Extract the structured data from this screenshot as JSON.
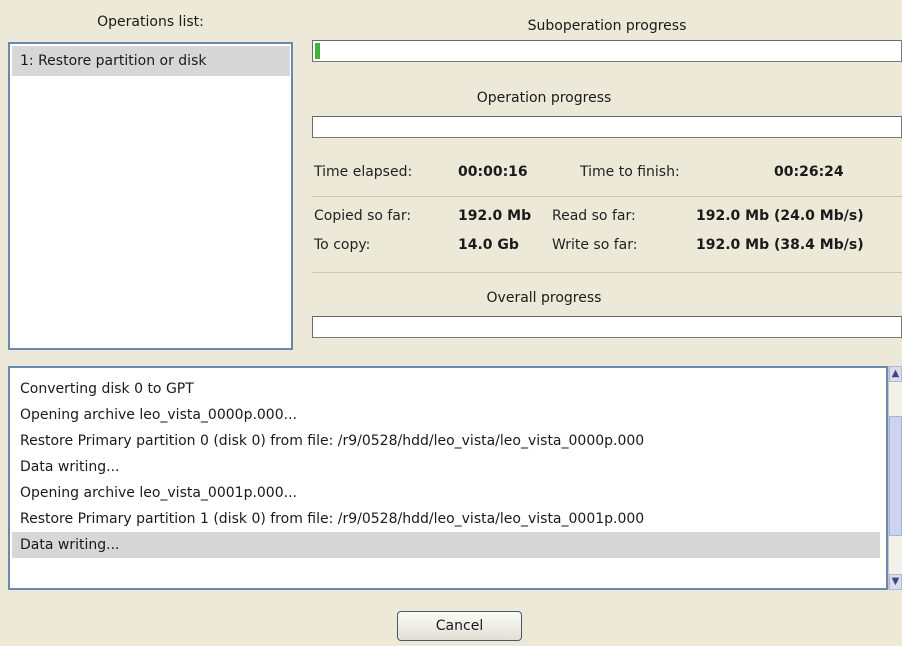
{
  "operations": {
    "header": "Operations list:",
    "items": [
      "1: Restore partition or disk"
    ]
  },
  "progress": {
    "sub_header": "Suboperation progress",
    "sub_fraction": 0.004,
    "op_header": "Operation progress",
    "op_fraction": 0.0,
    "overall_header": "Overall progress",
    "overall_fraction": 0.0
  },
  "stats": {
    "time_elapsed_label": "Time elapsed:",
    "time_elapsed_value": "00:00:16",
    "time_to_finish_label": "Time to finish:",
    "time_to_finish_value": "00:26:24",
    "copied_label": "Copied so far:",
    "copied_value": "192.0 Mb",
    "to_copy_label": "To copy:",
    "to_copy_value": "14.0 Gb",
    "read_label": "Read so far:",
    "read_value": "192.0 Mb (24.0 Mb/s)",
    "write_label": "Write so far:",
    "write_value": "192.0 Mb (38.4 Mb/s)"
  },
  "log": {
    "lines": [
      "Converting disk 0 to GPT",
      "Opening archive leo_vista_0000p.000...",
      "Restore Primary partition 0 (disk 0) from file: /r9/0528/hdd/leo_vista/leo_vista_0000p.000",
      "Data writing...",
      "Opening archive leo_vista_0001p.000...",
      "Restore Primary partition 1 (disk 0) from file: /r9/0528/hdd/leo_vista/leo_vista_0001p.000",
      "Data writing..."
    ]
  },
  "buttons": {
    "cancel": "Cancel"
  },
  "colors": {
    "progress_fill": "#3cb23c",
    "selection": "#d8d7d7",
    "border_accent": "#6b88b0"
  }
}
